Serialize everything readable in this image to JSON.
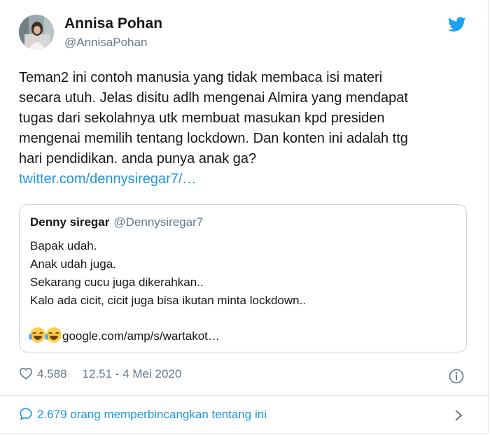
{
  "author": {
    "name": "Annisa Pohan",
    "handle": "@AnnisaPohan"
  },
  "tweet": {
    "lines": [
      "Teman2 ini contoh manusia yang tidak membaca isi materi",
      "secara utuh. Jelas disitu adlh mengenai Almira yang mendapat",
      "tugas dari sekolahnya utk membuat masukan kpd presiden",
      "mengenai memilih tentang lockdown. Dan konten ini adalah ttg",
      "hari pendidikan. anda punya anak ga?"
    ],
    "link": "twitter.com/dennysiregar7/…"
  },
  "quote": {
    "name": "Denny siregar",
    "handle": "@Dennysiregar7",
    "lines": [
      "Bapak udah.",
      "Anak udah juga.",
      "Sekarang cucu juga dikerahkan..",
      "Kalo ada cicit, cicit juga bisa ikutan minta lockdown.."
    ],
    "link": "google.com/amp/s/wartakot…",
    "emoji": "tears-of-joy-emoji"
  },
  "meta": {
    "likes": "4.588",
    "timestamp": "12.51 - 4 Mei 2020"
  },
  "footer": {
    "conversation": "2.679 orang memperbincangkan tentang ini"
  },
  "colors": {
    "link": "#1b95e0",
    "secondary_text": "#657786",
    "border": "#ccd6dd"
  }
}
